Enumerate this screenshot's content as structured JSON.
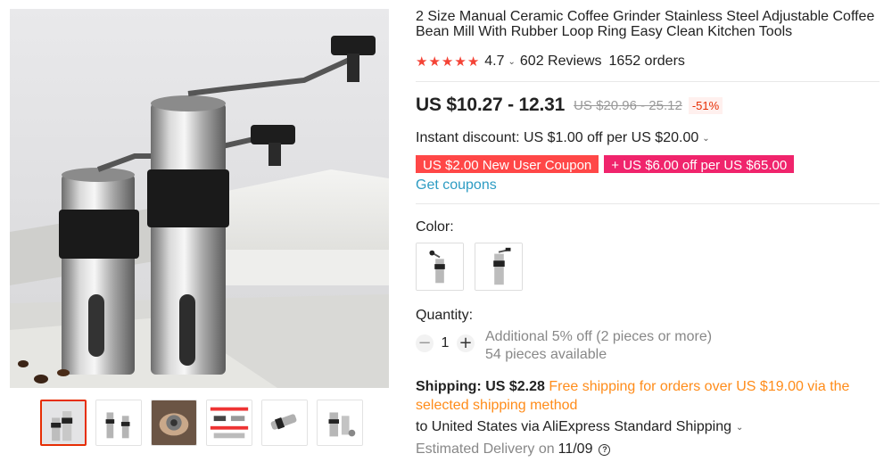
{
  "gallery": {
    "main_image_icon": "coffee-grinder-photo",
    "thumbnails": [
      {
        "icon": "grinder-pair-thumb",
        "active": true
      },
      {
        "icon": "grinder-parts-thumb",
        "active": false
      },
      {
        "icon": "grinder-in-hand-thumb",
        "active": false
      },
      {
        "icon": "size-chart-thumb",
        "active": false
      },
      {
        "icon": "grinder-lying-thumb",
        "active": false
      },
      {
        "icon": "grinder-components-thumb",
        "active": false
      }
    ]
  },
  "product": {
    "title": "2 Size Manual Ceramic Coffee Grinder Stainless Steel Adjustable Coffee Bean Mill With Rubber Loop Ring Easy Clean Kitchen Tools",
    "rating": "4.7",
    "stars": 5,
    "reviews": "602 Reviews",
    "orders": "1652 orders"
  },
  "price": {
    "current": "US $10.27 - 12.31",
    "original": "US $20.96 - 25.12",
    "discount": "-51%"
  },
  "promo": {
    "instant_discount": "Instant discount: US $1.00 off per US $20.00",
    "coupons": [
      "US $2.00 New User Coupon",
      "+ US $6.00 off per US $65.00"
    ],
    "get_coupons": "Get coupons"
  },
  "color": {
    "label": "Color:",
    "options": [
      "small-grinder-option",
      "large-grinder-option"
    ]
  },
  "quantity": {
    "label": "Quantity:",
    "value": "1",
    "minus": "−",
    "plus": "+",
    "note_discount": "Additional 5% off (2 pieces or more)",
    "available": "54 pieces available"
  },
  "shipping": {
    "label": "Shipping: US $2.28",
    "free_note": "Free shipping for orders over US $19.00 via the selected shipping method",
    "destination": "to United States via AliExpress Standard Shipping",
    "estimated_label": "Estimated Delivery on",
    "estimated_date": "11/09",
    "help": "?"
  },
  "colors": {
    "star": "#f44336",
    "discount": "#e62e04",
    "coupon_red": "#ff4747",
    "coupon_pink": "#f0246c",
    "link": "#2e9cc3",
    "free_shipping": "#ff8c1a"
  }
}
